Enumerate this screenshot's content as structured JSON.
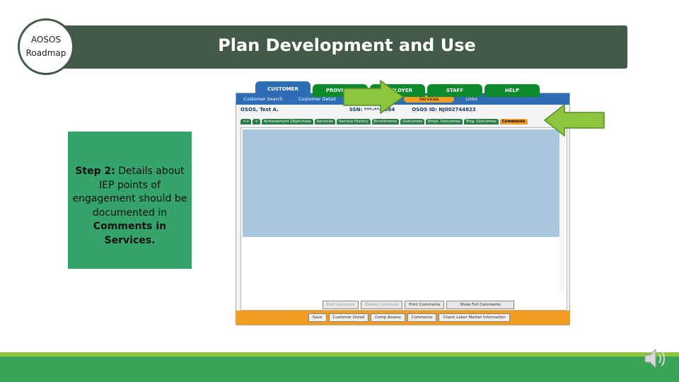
{
  "slide": {
    "title": "Plan Development and Use",
    "roadmap_line1": "AOSOS",
    "roadmap_line2": "Roadmap",
    "note_step_label": "Step 2:",
    "note_text": " Details about IEP points of engagement should be documented in ",
    "note_emphasis": "Comments in Services."
  },
  "app": {
    "top_tabs": [
      "CUSTOMER",
      "PROVIDER",
      "EMPLOYER",
      "STAFF",
      "HELP"
    ],
    "active_top_tab": "CUSTOMER",
    "subnav": {
      "customer_search": "Customer Search",
      "customer_detail": "Customer Detail",
      "services": "Services",
      "links": "Links"
    },
    "customer_name": "OSOS, Test A.",
    "ssn_label": "SSN: ***-**-6364",
    "osos_id_label": "OSOS ID: NJ002744823",
    "sub_tabs": [
      "Achievement Objectives",
      "Services",
      "Service History",
      "Enrollments",
      "Outcomes",
      "Empl. Outcomes",
      "Trng. Outcomes",
      "Comments"
    ],
    "active_sub_tab": "Comments",
    "nav_left": "<<",
    "nav_prev": "<",
    "panel_buttons": [
      "Edit Comment",
      "Delete Comment",
      "Print Comments",
      "Show Full Comments"
    ],
    "footer_buttons": [
      "Save",
      "Customer Detail",
      "Comp Assess",
      "Comments",
      "Check Labor Market Information"
    ]
  },
  "colors": {
    "header_bg": "#435a4a",
    "note_bg": "#34a46b",
    "arrow_fill": "#8cc63f",
    "tab_green": "#0d8a2c",
    "tab_blue": "#2d6db3",
    "accent_orange": "#f39c22",
    "band_green": "#3aa655"
  }
}
